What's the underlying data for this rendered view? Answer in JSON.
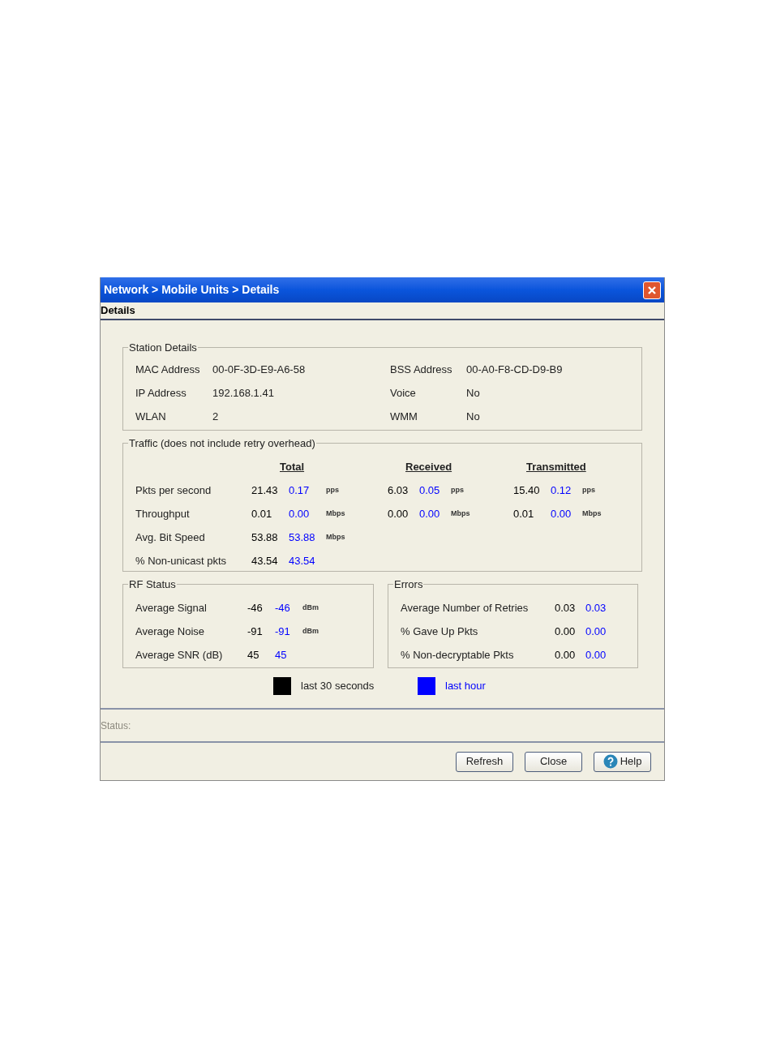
{
  "window": {
    "title": "Network > Mobile Units > Details"
  },
  "header": "Details",
  "station_details": {
    "title": "Station Details",
    "left": [
      {
        "label": "MAC Address",
        "value": "00-0F-3D-E9-A6-58"
      },
      {
        "label": "IP Address",
        "value": "192.168.1.41"
      },
      {
        "label": "WLAN",
        "value": "2"
      }
    ],
    "right": [
      {
        "label": "BSS Address",
        "value": "00-A0-F8-CD-D9-B9"
      },
      {
        "label": "Voice",
        "value": "No"
      },
      {
        "label": "WMM",
        "value": "No"
      }
    ]
  },
  "traffic": {
    "title": "Traffic (does not include retry overhead)",
    "columns": [
      "Total",
      "Received",
      "Transmitted"
    ],
    "rows": [
      {
        "label": "Pkts per second",
        "cells": [
          {
            "recent": "21.43",
            "hour": "0.17",
            "unit": "pps"
          },
          {
            "recent": "6.03",
            "hour": "0.05",
            "unit": "pps"
          },
          {
            "recent": "15.40",
            "hour": "0.12",
            "unit": "pps"
          }
        ]
      },
      {
        "label": "Throughput",
        "cells": [
          {
            "recent": "0.01",
            "hour": "0.00",
            "unit": "Mbps"
          },
          {
            "recent": "0.00",
            "hour": "0.00",
            "unit": "Mbps"
          },
          {
            "recent": "0.01",
            "hour": "0.00",
            "unit": "Mbps"
          }
        ]
      },
      {
        "label": "Avg. Bit Speed",
        "cells": [
          {
            "recent": "53.88",
            "hour": "53.88",
            "unit": "Mbps"
          }
        ]
      },
      {
        "label": "% Non-unicast pkts",
        "cells": [
          {
            "recent": "43.54",
            "hour": "43.54"
          }
        ]
      }
    ]
  },
  "rf_status": {
    "title": "RF Status",
    "rows": [
      {
        "label": "Average Signal",
        "recent": "-46",
        "hour": "-46",
        "unit": "dBm"
      },
      {
        "label": "Average Noise",
        "recent": "-91",
        "hour": "-91",
        "unit": "dBm"
      },
      {
        "label": "Average SNR (dB)",
        "recent": "45",
        "hour": "45"
      }
    ]
  },
  "errors": {
    "title": "Errors",
    "rows": [
      {
        "label": "Average Number of Retries",
        "recent": "0.03",
        "hour": "0.03"
      },
      {
        "label": "% Gave Up Pkts",
        "recent": "0.00",
        "hour": "0.00"
      },
      {
        "label": "% Non-decryptable Pkts",
        "recent": "0.00",
        "hour": "0.00"
      }
    ]
  },
  "legend": [
    {
      "label": "last 30 seconds",
      "color": "#000000"
    },
    {
      "label": "last hour",
      "color": "#0000ff"
    }
  ],
  "status": {
    "label": "Status:"
  },
  "buttons": [
    {
      "label": "Refresh",
      "kind": "plain"
    },
    {
      "label": "Close",
      "kind": "plain"
    },
    {
      "label": "Help",
      "kind": "help"
    }
  ]
}
